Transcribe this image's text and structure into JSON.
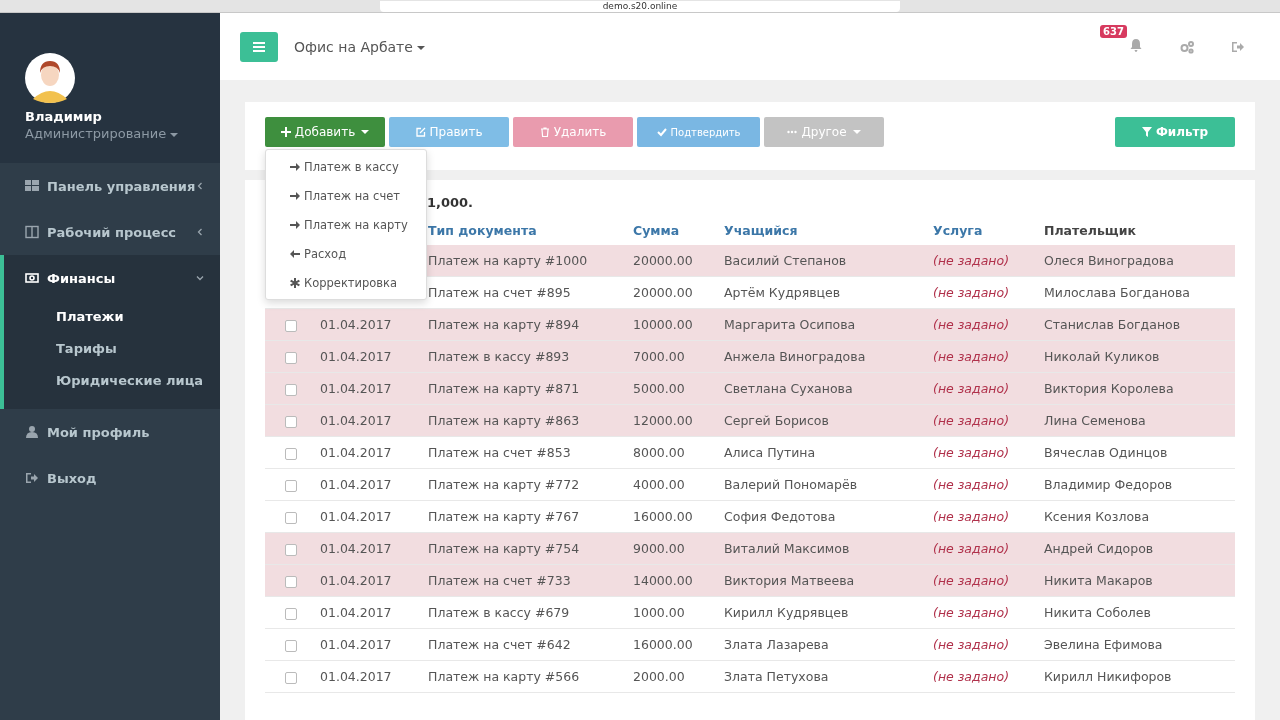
{
  "browser": {
    "url": "demo.s20.online"
  },
  "user": {
    "name": "Владимир",
    "role": "Администрирование"
  },
  "nav": [
    {
      "label": "Панель управления",
      "kind": "group",
      "expanded": false
    },
    {
      "label": "Рабочий процесс",
      "kind": "group",
      "expanded": false
    },
    {
      "label": "Финансы",
      "kind": "group",
      "expanded": true,
      "children": [
        {
          "label": "Платежи",
          "selected": true
        },
        {
          "label": "Тарифы",
          "selected": false
        },
        {
          "label": "Юридические лица",
          "selected": false
        }
      ]
    },
    {
      "label": "Мой профиль",
      "kind": "link"
    },
    {
      "label": "Выход",
      "kind": "link"
    }
  ],
  "header": {
    "office": "Офис на Арбате",
    "notifications": "637"
  },
  "toolbar": [
    {
      "label": "Добавить",
      "kind": "add"
    },
    {
      "label": "Править",
      "kind": "edit"
    },
    {
      "label": "Удалить",
      "kind": "delete"
    },
    {
      "label": "Подтвердить",
      "kind": "confirm"
    },
    {
      "label": "Другое",
      "kind": "other"
    },
    {
      "label": "Фильтр",
      "kind": "filter"
    }
  ],
  "add_menu": [
    {
      "label": "Платеж в кассу",
      "kind": "in"
    },
    {
      "label": "Платеж на счет",
      "kind": "in"
    },
    {
      "label": "Платеж на карту",
      "kind": "in"
    },
    {
      "label": "Расход",
      "kind": "out"
    },
    {
      "label": "Корректировка",
      "kind": "adjust"
    }
  ],
  "summary": "1,000.",
  "columns": [
    "Тип документа",
    "Сумма",
    "Учащийся",
    "Услуга",
    "Плательщик"
  ],
  "rows": [
    {
      "highlighted": true,
      "type": "Платеж на карту #1000",
      "sum": "20000.00",
      "student": "Василий Степанов",
      "service": "(не задано)",
      "payer": "Олеся Виноградова"
    },
    {
      "highlighted": false,
      "type": "Платеж на счет #895",
      "sum": "20000.00",
      "student": "Артём Кудрявцев",
      "service": "(не задано)",
      "payer": "Милослава Богданова"
    },
    {
      "highlighted": true,
      "checked": false,
      "date": "01.04.2017",
      "type": "Платеж на карту #894",
      "sum": "10000.00",
      "student": "Маргарита Осипова",
      "service": "(не задано)",
      "payer": "Станислав Богданов"
    },
    {
      "highlighted": true,
      "checked": false,
      "date": "01.04.2017",
      "type": "Платеж в кассу #893",
      "sum": "7000.00",
      "student": "Анжела Виноградова",
      "service": "(не задано)",
      "payer": "Николай Куликов"
    },
    {
      "highlighted": true,
      "checked": false,
      "date": "01.04.2017",
      "type": "Платеж на карту #871",
      "sum": "5000.00",
      "student": "Светлана Суханова",
      "service": "(не задано)",
      "payer": "Виктория Королева"
    },
    {
      "highlighted": true,
      "checked": false,
      "date": "01.04.2017",
      "type": "Платеж на карту #863",
      "sum": "12000.00",
      "student": "Сергей Борисов",
      "service": "(не задано)",
      "payer": "Лина Семенова"
    },
    {
      "highlighted": false,
      "checked": false,
      "date": "01.04.2017",
      "type": "Платеж на счет #853",
      "sum": "8000.00",
      "student": "Алиса Путина",
      "service": "(не задано)",
      "payer": "Вячеслав Одинцов"
    },
    {
      "highlighted": false,
      "checked": false,
      "date": "01.04.2017",
      "type": "Платеж на карту #772",
      "sum": "4000.00",
      "student": "Валерий Пономарёв",
      "service": "(не задано)",
      "payer": "Владимир Федоров"
    },
    {
      "highlighted": false,
      "checked": false,
      "date": "01.04.2017",
      "type": "Платеж на карту #767",
      "sum": "16000.00",
      "student": "София Федотова",
      "service": "(не задано)",
      "payer": "Ксения Козлова"
    },
    {
      "highlighted": true,
      "checked": false,
      "date": "01.04.2017",
      "type": "Платеж на карту #754",
      "sum": "9000.00",
      "student": "Виталий Максимов",
      "service": "(не задано)",
      "payer": "Андрей Сидоров"
    },
    {
      "highlighted": true,
      "checked": false,
      "date": "01.04.2017",
      "type": "Платеж на счет #733",
      "sum": "14000.00",
      "student": "Виктория Матвеева",
      "service": "(не задано)",
      "payer": "Никита Макаров"
    },
    {
      "highlighted": false,
      "checked": false,
      "date": "01.04.2017",
      "type": "Платеж в кассу #679",
      "sum": "1000.00",
      "student": "Кирилл Кудрявцев",
      "service": "(не задано)",
      "payer": "Никита Соболев"
    },
    {
      "highlighted": false,
      "checked": false,
      "date": "01.04.2017",
      "type": "Платеж на счет #642",
      "sum": "16000.00",
      "student": "Злата Лазарева",
      "service": "(не задано)",
      "payer": "Эвелина Ефимова"
    },
    {
      "highlighted": false,
      "checked": false,
      "date": "01.04.2017",
      "type": "Платеж на карту #566",
      "sum": "2000.00",
      "student": "Злата Петухова",
      "service": "(не задано)",
      "payer": "Кирилл Никифоров"
    }
  ]
}
